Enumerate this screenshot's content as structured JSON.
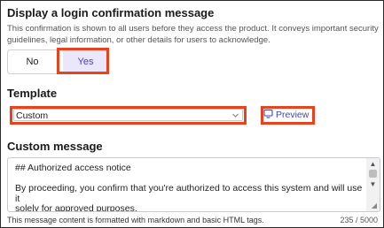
{
  "login_message": {
    "heading": "Display a login confirmation message",
    "description_line1": "This confirmation is shown to all users before they access the product. It conveys important security",
    "description_line2": "guidelines, legal information, or other details for users to acknowledge.",
    "options": [
      "No",
      "Yes"
    ],
    "selected": "Yes"
  },
  "template": {
    "heading": "Template",
    "selected_value": "Custom",
    "preview_label": "Preview"
  },
  "custom_message": {
    "heading": "Custom message",
    "lines": [
      "## Authorized access notice",
      "",
      "By proceeding, you confirm that you're authorized to access this system and will use it",
      "solely for approved purposes."
    ],
    "footer_note": "This message content is formatted with markdown and basic HTML tags.",
    "char_count": "235 / 5000"
  },
  "colors": {
    "accent": "#4b3fb5",
    "selected_bg": "#ebe7fb",
    "highlight": "#e8431e",
    "link": "#3a49b4"
  },
  "icons": [
    "preview-icon",
    "chevron-down-icon",
    "scroll-up-icon",
    "scroll-down-icon",
    "resize-handle-icon"
  ]
}
